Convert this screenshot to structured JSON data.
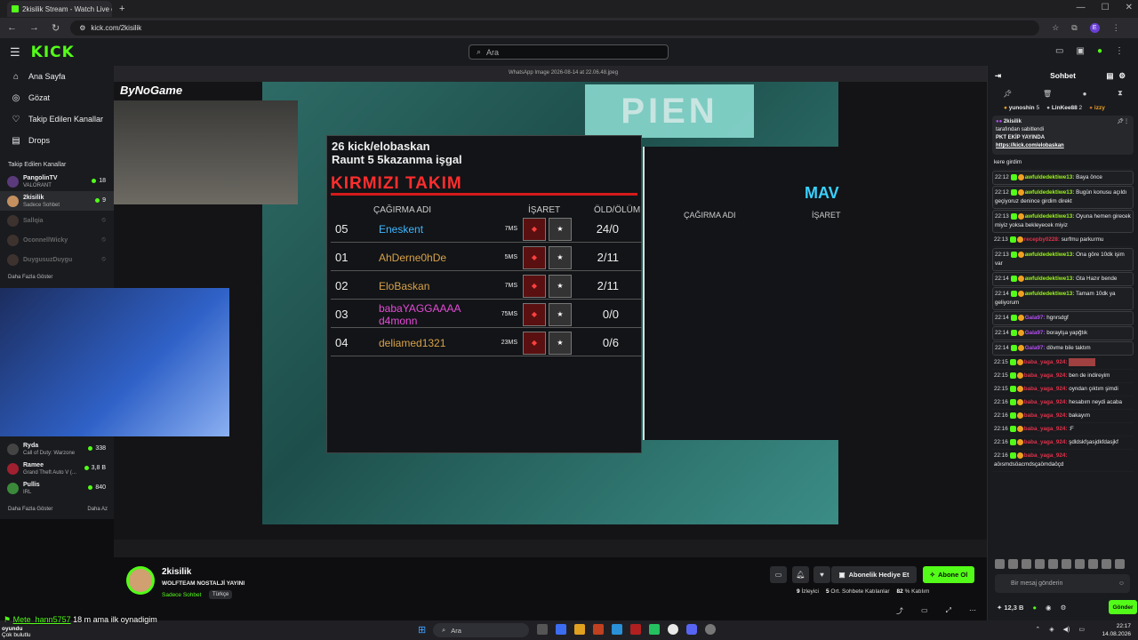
{
  "browser": {
    "tab_title": "2kisilik Stream - Watch Live on",
    "url": "kick.com/2kisilik",
    "profile": "E"
  },
  "site": {
    "logo": "KICK",
    "search_placeholder": "Ara"
  },
  "sidebar": {
    "nav": [
      {
        "label": "Ana Sayfa",
        "icon": "home-icon"
      },
      {
        "label": "Gözat",
        "icon": "compass-icon"
      },
      {
        "label": "Takip Edilen Kanallar",
        "icon": "heart-icon"
      },
      {
        "label": "Drops",
        "icon": "gift-icon"
      }
    ],
    "followed_title": "Takip Edilen Kanallar",
    "followed": [
      {
        "name": "PangolinTV",
        "sub": "VALORANT",
        "viewers": "18",
        "live": true
      },
      {
        "name": "2kisilik",
        "sub": "Sadece Sohbet",
        "viewers": "9",
        "live": true
      },
      {
        "name": "Sallqia",
        "sub": "",
        "viewers": "",
        "live": false
      },
      {
        "name": "OconnellWicky",
        "sub": "",
        "viewers": "",
        "live": false
      },
      {
        "name": "DuygusuzDuygu",
        "sub": "",
        "viewers": "",
        "live": false
      }
    ],
    "more": "Daha Fazla Göster",
    "recommended": [
      {
        "name": "Ryda",
        "sub": "Call of Duty: Warzone",
        "viewers": "338"
      },
      {
        "name": "Ramee",
        "sub": "Grand Theft Auto V (...",
        "viewers": "3,8 B"
      },
      {
        "name": "Pullis",
        "sub": "IRL",
        "viewers": "840"
      }
    ],
    "more2": "Daha Fazla Göster",
    "less": "Daha Az"
  },
  "stream_overlay": {
    "brand": "ByNoGame",
    "window_title": "WhatsApp Image 2026-08-14 at 22.06.48.jpeg"
  },
  "game": {
    "pien": "PIEN",
    "header1": "26 kick/elobaskan",
    "header2": "Raunt 5  5kazanma işgal",
    "team_red": "KIRMIZI TAKIM",
    "team_blue": "MAV",
    "col_name": "ÇAĞIRMA ADI",
    "col_mark": "İŞARET",
    "col_kd": "ÖLD/ÖLÜM",
    "col_name2": "ÇAĞIRMA ADI",
    "col_mark2": "İŞARET",
    "players": [
      {
        "rank": "05",
        "name": "Eneskent",
        "ms": "7MS",
        "kd": "24/0",
        "color": "#3fb7ff"
      },
      {
        "rank": "01",
        "name": "AhDerne0hDe",
        "ms": "5MS",
        "kd": "2/11",
        "color": "#d8a24a"
      },
      {
        "rank": "02",
        "name": "EloBaskan",
        "ms": "7MS",
        "kd": "2/11",
        "color": "#d8a24a"
      },
      {
        "rank": "03",
        "name": "babaYAGGAAAA d4monn",
        "ms": "75MS",
        "kd": "0/0",
        "color": "#e64bd8"
      },
      {
        "rank": "04",
        "name": "deliamed1321",
        "ms": "23MS",
        "kd": "0/6",
        "color": "#d8a24a"
      }
    ]
  },
  "stream": {
    "name": "2kisilik",
    "title": "WOLFTEAM NOSTALJİ YAYINI",
    "category": "Sadece Sohbet",
    "language": "Türkçe",
    "gift_label": "Abonelik Hediye Et",
    "follow_label": "Abone Ol",
    "viewers": "9",
    "viewers_label": "İzleyici",
    "avg": "5",
    "avg_label": "Ort. Sohbete Katılanlar",
    "pct": "82",
    "pct_label": "% Katılım"
  },
  "chat": {
    "title": "Sohbet",
    "gifters": [
      {
        "name": "yunoshin",
        "n": "5"
      },
      {
        "name": "LinKee88",
        "n": "2"
      },
      {
        "name": "izzy",
        "n": ""
      }
    ],
    "pinned": {
      "user": "2kisilik",
      "line1": "tarafından sabitlendi",
      "line2": "PKT EKİP YAYINDA",
      "link": "https://kick.com/elobaskan"
    },
    "messages": [
      {
        "time": "",
        "user": "",
        "text": "kere girdim",
        "cls": ""
      },
      {
        "time": "22:12",
        "user": "awfuldedektiwe13:",
        "text": "Baya önce",
        "cls": "u-g",
        "hl": true
      },
      {
        "time": "22:12",
        "user": "awfuldedektiwe13:",
        "text": "Bugün konusu açıldı geçiyoruz denince girdim direkt",
        "cls": "u-g",
        "hl": true
      },
      {
        "time": "22:13",
        "user": "awfuldedektiwe13:",
        "text": "Oyuna hemen girecek miyiz yoksa bekleyecek miyiz",
        "cls": "u-g",
        "hl": true
      },
      {
        "time": "22:13",
        "user": "recepby0228:",
        "text": "surfmu parkurmu",
        "cls": "u-r"
      },
      {
        "time": "22:13",
        "user": "awfuldedektiwe13:",
        "text": "Ona göre 10dk işim var",
        "cls": "u-g",
        "hl": true
      },
      {
        "time": "22:14",
        "user": "awfuldedektiwe13:",
        "text": "Gta Hazır bende",
        "cls": "u-g",
        "hl": true
      },
      {
        "time": "22:14",
        "user": "awfuldedektiwe13:",
        "text": "Tamam 10dk ya geliyorum",
        "cls": "u-g",
        "hl": true
      },
      {
        "time": "22:14",
        "user": "Gala97:",
        "text": "hgnrsdgf",
        "cls": "u-p",
        "hl": true
      },
      {
        "time": "22:14",
        "user": "Gala97:",
        "text": "boraylşa yapğtık",
        "cls": "u-p",
        "hl": true
      },
      {
        "time": "22:14",
        "user": "Gala97:",
        "text": "dövme bile taktım",
        "cls": "u-p",
        "hl": true
      },
      {
        "time": "22:15",
        "user": "baba_yaga_924:",
        "text": "",
        "cls": "u-r"
      },
      {
        "time": "22:15",
        "user": "baba_yaga_924:",
        "text": "ben de indireyim",
        "cls": "u-r"
      },
      {
        "time": "22:15",
        "user": "baba_yaga_924:",
        "text": "oyndan çıktım şimdi",
        "cls": "u-r"
      },
      {
        "time": "22:16",
        "user": "baba_yaga_924:",
        "text": "hesabım neydi acaba",
        "cls": "u-r"
      },
      {
        "time": "22:16",
        "user": "baba_yaga_924:",
        "text": "bakayım",
        "cls": "u-r"
      },
      {
        "time": "22:16",
        "user": "baba_yaga_924:",
        "text": ":F",
        "cls": "u-r"
      },
      {
        "time": "22:16",
        "user": "baba_yaga_924:",
        "text": "şdldskfşasjdkfdasjkf",
        "cls": "u-r"
      },
      {
        "time": "22:16",
        "user": "baba_yaga_924:",
        "text": "aöısmdsöacmdsçaömdaöçd",
        "cls": "u-r"
      }
    ],
    "input_placeholder": "Bir mesaj gönderin",
    "points": "12,3 B",
    "send": "Gönder"
  },
  "overlay_chat": {
    "user": "Mete_hann5757",
    "text": "18 m ama ilk oynadigim"
  },
  "windows": {
    "search": "Ara",
    "weather": "oyundu",
    "weather2": "Çok bulutlu",
    "time": "22:17",
    "date": "14.08.2026"
  }
}
